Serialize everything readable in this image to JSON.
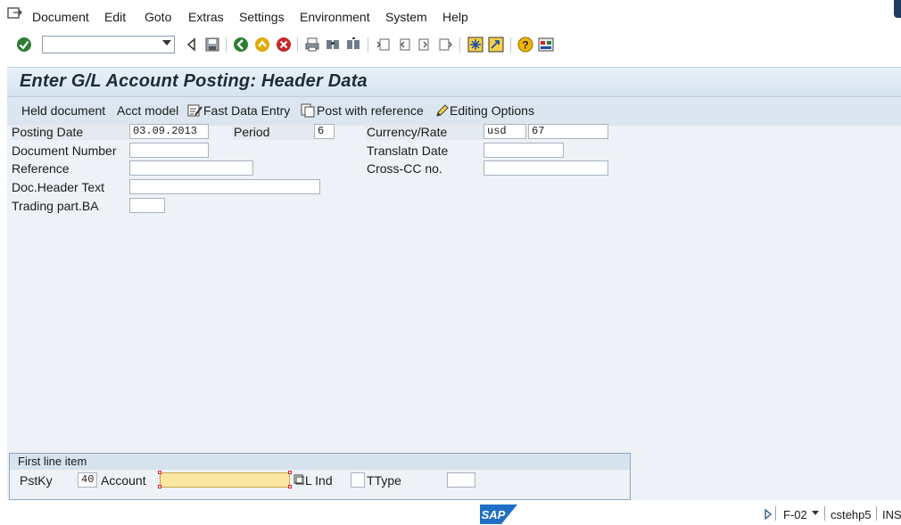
{
  "menu": {
    "items": [
      "Document",
      "Edit",
      "Goto",
      "Extras",
      "Settings",
      "Environment",
      "System",
      "Help"
    ]
  },
  "toolbar": {
    "command_field_value": "",
    "icons": [
      "enter-icon",
      "back-icon",
      "save-icon",
      "back-nav-icon",
      "exit-icon",
      "cancel-icon",
      "print-icon",
      "find-icon",
      "find-next-icon",
      "first-page-icon",
      "previous-page-icon",
      "next-page-icon",
      "last-page-icon",
      "create-session-icon",
      "shortcut-icon",
      "help-icon",
      "customize-layout-icon"
    ]
  },
  "title": "Enter G/L Account Posting: Header Data",
  "app_toolbar": {
    "held_document": "Held document",
    "acct_model": "Acct model",
    "fast_data_entry": "Fast Data Entry",
    "post_with_reference": "Post with reference",
    "editing_options": "Editing Options"
  },
  "header": {
    "posting_date": {
      "label": "Posting Date",
      "value": "03.09.2013"
    },
    "period": {
      "label": "Period",
      "value": "6"
    },
    "currency_rate": {
      "label": "Currency/Rate",
      "currency": "usd",
      "rate": "67"
    },
    "document_number": {
      "label": "Document Number",
      "value": ""
    },
    "translatn_date": {
      "label": "Translatn Date",
      "value": ""
    },
    "reference": {
      "label": "Reference",
      "value": ""
    },
    "cross_cc": {
      "label": "Cross-CC no.",
      "value": ""
    },
    "doc_header_text": {
      "label": "Doc.Header Text",
      "value": ""
    },
    "trading_part_ba": {
      "label": "Trading part.BA",
      "value": ""
    }
  },
  "first_line_item": {
    "group_title": "First line item",
    "pstky": {
      "label": "PstKy",
      "value": "40"
    },
    "account": {
      "label": "Account",
      "value": ""
    },
    "sgl_ind": {
      "label": "L Ind",
      "value": ""
    },
    "ttype": {
      "label": "TType",
      "value": ""
    }
  },
  "status": {
    "logo": "SAP",
    "transaction": "F-02",
    "server": "cstehp5",
    "mode": "INS"
  },
  "colors": {
    "title_bg": "#d4e3f0",
    "app_toolbar_bg": "#dbe6f0",
    "form_bg": "#eef2f6",
    "account_field_bg": "#fbe7a1",
    "sap_logo": "#1f6fc5"
  }
}
